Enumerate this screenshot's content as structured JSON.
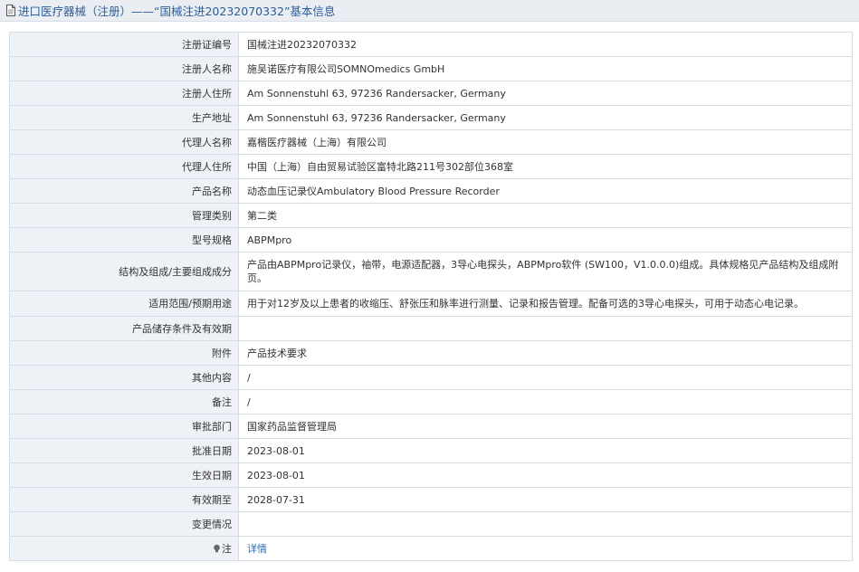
{
  "header": {
    "title": "进口医疗器械（注册）——“国械注进20232070332”基本信息"
  },
  "rows": [
    {
      "label": "注册证编号",
      "value": "国械注进20232070332"
    },
    {
      "label": "注册人名称",
      "value": "施吴诺医疗有限公司SOMNOmedics GmbH"
    },
    {
      "label": "注册人住所",
      "value": "Am Sonnenstuhl 63, 97236 Randersacker, Germany"
    },
    {
      "label": "生产地址",
      "value": "Am Sonnenstuhl 63, 97236 Randersacker, Germany"
    },
    {
      "label": "代理人名称",
      "value": "嘉楷医疗器械（上海）有限公司"
    },
    {
      "label": "代理人住所",
      "value": "中国（上海）自由贸易试验区富特北路211号302部位368室"
    },
    {
      "label": "产品名称",
      "value": "动态血压记录仪Ambulatory Blood Pressure Recorder"
    },
    {
      "label": "管理类别",
      "value": "第二类"
    },
    {
      "label": "型号规格",
      "value": "ABPMpro"
    },
    {
      "label": "结构及组成/主要组成成分",
      "value": "产品由ABPMpro记录仪，袖带，电源适配器，3导心电探头，ABPMpro软件 (SW100，V1.0.0.0)组成。具体规格见产品结构及组成附页。"
    },
    {
      "label": "适用范围/预期用途",
      "value": "用于对12岁及以上患者的收缩压、舒张压和脉率进行测量、记录和报告管理。配备可选的3导心电探头，可用于动态心电记录。"
    },
    {
      "label": "产品储存条件及有效期",
      "value": ""
    },
    {
      "label": "附件",
      "value": "产品技术要求"
    },
    {
      "label": "其他内容",
      "value": "/"
    },
    {
      "label": "备注",
      "value": "/"
    },
    {
      "label": "审批部门",
      "value": "国家药品监督管理局"
    },
    {
      "label": "批准日期",
      "value": "2023-08-01"
    },
    {
      "label": "生效日期",
      "value": "2023-08-01"
    },
    {
      "label": "有效期至",
      "value": "2028-07-31"
    },
    {
      "label": "变更情况",
      "value": ""
    },
    {
      "label": "注",
      "value": "详情"
    }
  ],
  "icons": {
    "header": "document-icon",
    "note": "lightbulb-icon"
  },
  "colors": {
    "header_text": "#2b5d9a",
    "label_bg": "#eef2f7",
    "border": "#d4dce6",
    "link": "#2b6cb8"
  }
}
